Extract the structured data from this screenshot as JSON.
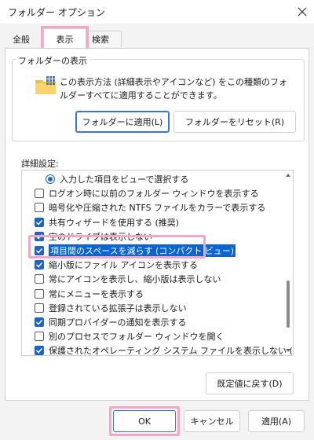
{
  "window": {
    "title": "フォルダー オプション"
  },
  "tabs": [
    {
      "label": "全般"
    },
    {
      "label": "表示"
    },
    {
      "label": "検索"
    }
  ],
  "folder_views": {
    "group_label": "フォルダーの表示",
    "description": "この表示方法 (詳細表示やアイコンなど) をこの種類のフォルダーすべてに適用することができます。",
    "apply_button": "フォルダーに適用(L)",
    "reset_button": "フォルダーをリセット(R)"
  },
  "advanced": {
    "label": "詳細設定:",
    "items": [
      {
        "type": "radio",
        "checked": true,
        "label": "入力した項目をビューで選択する"
      },
      {
        "type": "checkbox",
        "checked": false,
        "label": "ログオン時に以前のフォルダー ウィンドウを表示する"
      },
      {
        "type": "checkbox",
        "checked": false,
        "label": "暗号化や圧縮された NTFS ファイルをカラーで表示する"
      },
      {
        "type": "checkbox",
        "checked": true,
        "label": "共有ウィザードを使用する (推奨)"
      },
      {
        "type": "checkbox",
        "checked": true,
        "label": "空のドライブは表示しない"
      },
      {
        "type": "checkbox",
        "checked": true,
        "label": "項目間のスペースを減らす (コンパクト ビュー)",
        "selected": true
      },
      {
        "type": "checkbox",
        "checked": true,
        "label": "縮小版にファイル アイコンを表示する"
      },
      {
        "type": "checkbox",
        "checked": false,
        "label": "常にアイコンを表示し、縮小版は表示しない"
      },
      {
        "type": "checkbox",
        "checked": false,
        "label": "常にメニューを表示する"
      },
      {
        "type": "checkbox",
        "checked": false,
        "label": "登録されている拡張子は表示しない"
      },
      {
        "type": "checkbox",
        "checked": true,
        "label": "同期プロバイダーの通知を表示する"
      },
      {
        "type": "checkbox",
        "checked": false,
        "label": "別のプロセスでフォルダー ウィンドウを開く"
      },
      {
        "type": "checkbox",
        "checked": true,
        "label": "保護されたオペレーティング システム ファイルを表示しない (推奨)"
      }
    ],
    "restore_defaults": "既定値に戻す(D)"
  },
  "footer": {
    "ok": "OK",
    "cancel": "キャンセル",
    "apply": "適用(A)"
  },
  "colors": {
    "accent": "#1f62c8",
    "highlight": "#f4a6c6"
  }
}
